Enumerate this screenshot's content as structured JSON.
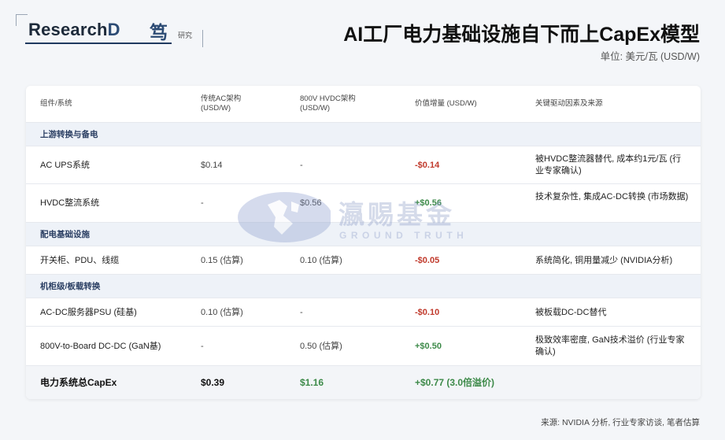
{
  "logo": {
    "text_main": "Research",
    "text_d": "D",
    "cn": "笃",
    "sub": "研究"
  },
  "title": "AI工厂电力基础设施自下而上CapEx模型",
  "unit": "单位: 美元/瓦 (USD/W)",
  "table": {
    "headers": [
      "组件/系统",
      "传统AC架构\n(USD/W)",
      "800V HVDC架构\n(USD/W)",
      "价值增量 (USD/W)",
      "关键驱动因素及来源"
    ],
    "sections": [
      {
        "title": "上游转换与备电",
        "rows": [
          {
            "c1": "AC UPS系统",
            "c2": "$0.14",
            "c3": "-",
            "c4": "-$0.14",
            "c5": "被HVDC整流器替代, 成本约1元/瓦 (行业专家确认)"
          },
          {
            "c1": "HVDC整流系统",
            "c2": "-",
            "c3": "$0.56",
            "c4": "+$0.56",
            "c5": "技术复杂性, 集成AC-DC转换 (市场数据)"
          }
        ]
      },
      {
        "title": "配电基础设施",
        "rows": [
          {
            "c1": "开关柜、PDU、线缆",
            "c2": "0.15 (估算)",
            "c3": "0.10 (估算)",
            "c4": "-$0.05",
            "c5": "系统简化, 铜用量减少 (NVIDIA分析)"
          }
        ]
      },
      {
        "title": "机柜级/板载转换",
        "rows": [
          {
            "c1": "AC-DC服务器PSU (硅基)",
            "c2": "0.10 (估算)",
            "c3": "-",
            "c4": "-$0.10",
            "c5": "被板载DC-DC替代"
          },
          {
            "c1": "800V-to-Board DC-DC (GaN基)",
            "c2": "-",
            "c3": "0.50 (估算)",
            "c4": "+$0.50",
            "c5": "极致效率密度, GaN技术溢价 (行业专家确认)"
          }
        ]
      }
    ],
    "total": {
      "c1": "电力系统总CapEx",
      "c2": "$0.39",
      "c3": "$1.16",
      "c4": "+$0.77 (3.0倍溢价)"
    }
  },
  "source": "来源: NVIDIA 分析, 行业专家访谈, 笔者估算",
  "watermark": {
    "cn": "瀛赐基金",
    "en": "GROUND TRUTH"
  }
}
